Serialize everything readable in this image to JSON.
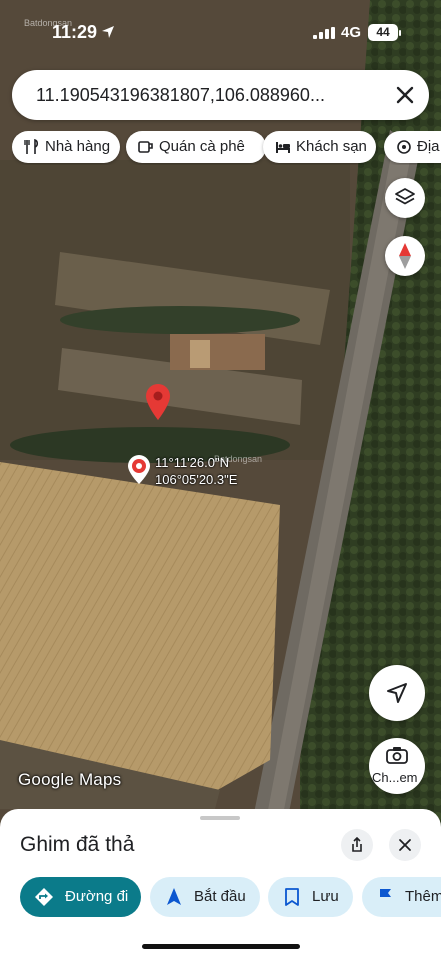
{
  "status_bar": {
    "time": "11:29",
    "network": "4G",
    "battery": "44",
    "watermark": "Batdongsan"
  },
  "search": {
    "query": "11.190543196381807,106.088960...",
    "close_icon": "close-icon"
  },
  "chips": [
    {
      "label": "Nhà hàng",
      "icon": "restaurant-icon"
    },
    {
      "label": "Quán cà phê",
      "icon": "coffee-icon"
    },
    {
      "label": "Khách sạn",
      "icon": "hotel-icon"
    },
    {
      "label": "Địa",
      "icon": "attraction-icon"
    }
  ],
  "map": {
    "coord_lat": "11°11'26.0\"N",
    "coord_lng": "106°05'20.3\"E",
    "coord_watermark": "Batdongsan",
    "attribution": "Google Maps",
    "street_view_label": "Ch...em"
  },
  "sheet": {
    "title": "Ghim đã thả",
    "actions": [
      {
        "label": "Đường đi",
        "icon": "directions-icon",
        "primary": true
      },
      {
        "label": "Bắt đầu",
        "icon": "navigation-icon",
        "primary": false
      },
      {
        "label": "Lưu",
        "icon": "bookmark-icon",
        "primary": false
      },
      {
        "label": "Thêm",
        "icon": "flag-icon",
        "primary": false
      }
    ]
  },
  "colors": {
    "accent": "#0b7b8a",
    "pin": "#e53935",
    "secondary_button": "#d9eef8"
  }
}
